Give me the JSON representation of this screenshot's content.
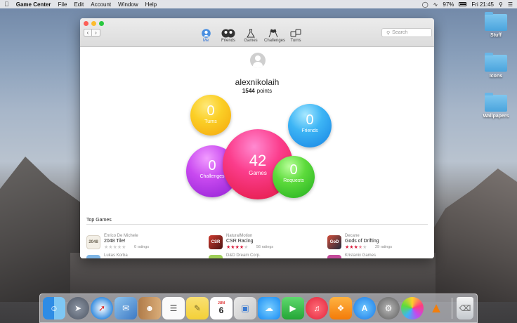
{
  "menubar": {
    "app_name": "Game Center",
    "items": [
      "File",
      "Edit",
      "Account",
      "Window",
      "Help"
    ],
    "battery": "97%",
    "clock": "Fri 21:45"
  },
  "desktop": {
    "items": [
      {
        "label": "Stuff"
      },
      {
        "label": "Icons"
      },
      {
        "label": "Wallpapers"
      }
    ]
  },
  "toolbar": {
    "back": "‹",
    "forward": "›",
    "tabs": [
      {
        "label": "Me"
      },
      {
        "label": "Friends"
      },
      {
        "label": "Games"
      },
      {
        "label": "Challenges"
      },
      {
        "label": "Turns"
      }
    ],
    "search_placeholder": "Search"
  },
  "profile": {
    "username": "alexnikolaih",
    "points": "1544",
    "points_label": "points"
  },
  "bubbles": {
    "turns": {
      "value": "0",
      "label": "Turns"
    },
    "games": {
      "value": "42",
      "label": "Games"
    },
    "friends": {
      "value": "0",
      "label": "Friends"
    },
    "challenges": {
      "value": "0",
      "label": "Challenges"
    },
    "requests": {
      "value": "0",
      "label": "Requests"
    }
  },
  "top_games": {
    "title": "Top Games",
    "games": [
      {
        "developer": "Enrico De Michele",
        "name": "2048 Tile!",
        "icon_text": "2048",
        "stars": 0,
        "ratings": "0 ratings"
      },
      {
        "developer": "NaturalMotion",
        "name": "CSR Racing",
        "icon_text": "CSR",
        "stars": 4,
        "ratings": "56 ratings"
      },
      {
        "developer": "Decane",
        "name": "Gods of Drifting",
        "icon_text": "GoD",
        "stars": 3.5,
        "ratings": "29 ratings"
      }
    ],
    "next_row": [
      {
        "developer": "Lukas Korba"
      },
      {
        "developer": "D&D Dream Corp."
      },
      {
        "developer": "Kristanix Games"
      }
    ]
  },
  "dock": {
    "calendar_month": "JUN",
    "calendar_day": "6"
  }
}
